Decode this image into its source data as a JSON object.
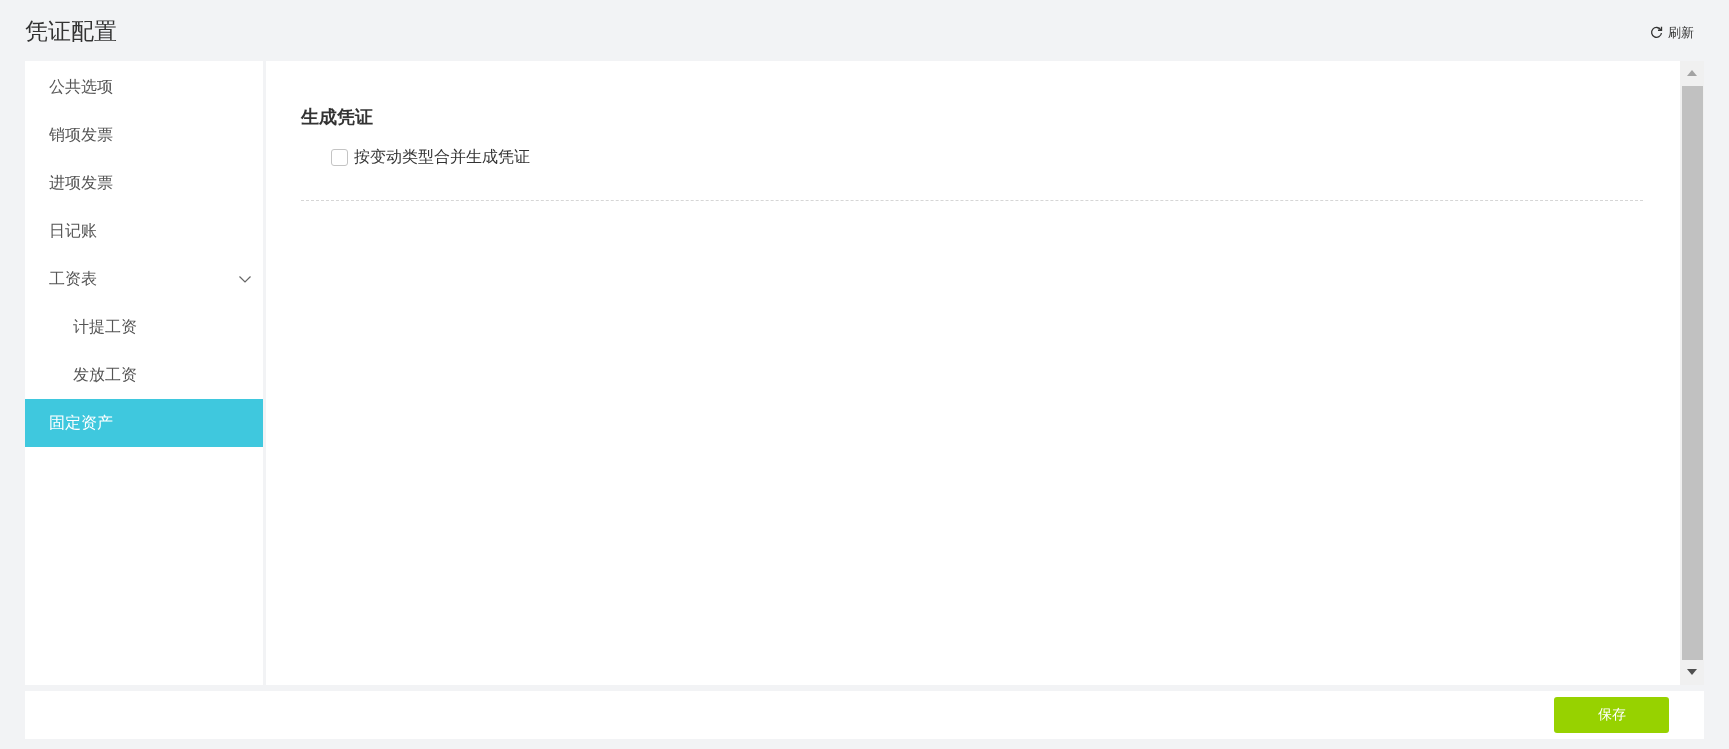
{
  "header": {
    "title": "凭证配置",
    "refresh_button": {
      "label": "刷新"
    }
  },
  "sidebar": {
    "items": [
      {
        "label": "公共选项",
        "selected": false
      },
      {
        "label": "销项发票",
        "selected": false
      },
      {
        "label": "进项发票",
        "selected": false
      },
      {
        "label": "日记账",
        "selected": false
      },
      {
        "label": "工资表",
        "selected": false,
        "expanded": true,
        "children": [
          {
            "label": "计提工资",
            "selected": false
          },
          {
            "label": "发放工资",
            "selected": false
          }
        ]
      },
      {
        "label": "固定资产",
        "selected": true
      }
    ]
  },
  "content": {
    "section_title": "生成凭证",
    "options": [
      {
        "label": "按变动类型合并生成凭证",
        "checked": false
      }
    ]
  },
  "footer": {
    "save_button": {
      "label": "保存"
    }
  }
}
